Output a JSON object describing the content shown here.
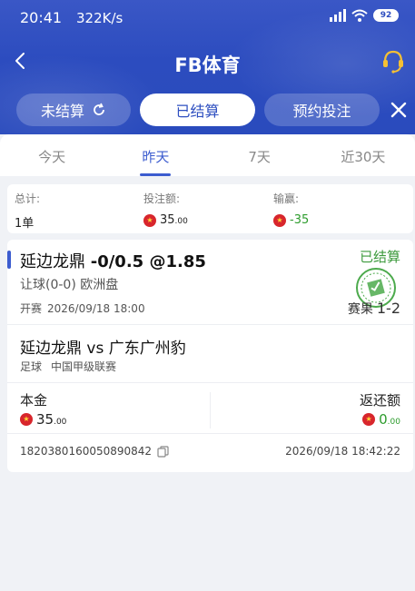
{
  "status_bar": {
    "time": "20:41",
    "speed": "322K/s",
    "battery": "92"
  },
  "header": {
    "title": "FB体育",
    "tabs": [
      {
        "label": "未结算",
        "active": false
      },
      {
        "label": "已结算",
        "active": true
      },
      {
        "label": "预约投注",
        "active": false
      }
    ]
  },
  "date_tabs": [
    "今天",
    "昨天",
    "7天",
    "近30天"
  ],
  "date_tabs_active_index": 1,
  "summary": {
    "total_label": "总计:",
    "total_value": "1单",
    "stake_label": "投注额:",
    "stake_int": "35",
    "stake_dec": ".00",
    "winloss_label": "输赢:",
    "winloss_value": "-35"
  },
  "bet": {
    "team": "延边龙鼎",
    "handicap_odds": "-0/0.5 @1.85",
    "status": "已结算",
    "market": "让球(0-0) 欧洲盘",
    "open_label": "开赛",
    "open_time": "2026/09/18 18:00",
    "result_label": "赛果",
    "result_score": "1-2",
    "match": "延边龙鼎 vs 广东广州豹",
    "sport": "足球",
    "league": "中国甲级联赛",
    "principal_label": "本金",
    "principal_int": "35",
    "principal_dec": ".00",
    "return_label": "返还额",
    "return_int": "0",
    "return_dec": ".00",
    "order_no": "1820380160050890842",
    "order_time": "2026/09/18 18:42:22"
  },
  "colors": {
    "header_blue": "#2c4cbf",
    "accent": "#3c5ccf",
    "green": "#2d9c2d",
    "flag_red": "#d8262c"
  },
  "icons": [
    "back-arrow-icon",
    "support-headset-icon",
    "refresh-icon",
    "close-icon",
    "china-flag-icon",
    "settled-stamp-icon",
    "copy-icon"
  ]
}
